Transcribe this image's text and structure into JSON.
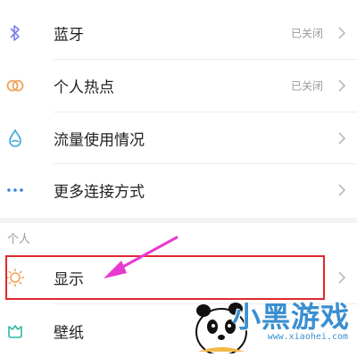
{
  "settings": {
    "items": [
      {
        "label": "蓝牙",
        "status": "已关闭",
        "icon": "bluetooth-icon",
        "icon_color": "#7b7fe6"
      },
      {
        "label": "个人热点",
        "status": "已关闭",
        "icon": "hotspot-icon",
        "icon_color": "#f0a25a"
      },
      {
        "label": "流量使用情况",
        "status": "",
        "icon": "data-usage-icon",
        "icon_color": "#3aa7d9"
      },
      {
        "label": "更多连接方式",
        "status": "",
        "icon": "more-connections-icon",
        "icon_color": "#3a7fd9"
      }
    ],
    "personal_section": {
      "header": "个人",
      "items": [
        {
          "label": "显示",
          "icon": "display-icon",
          "icon_color": "#f0a25a",
          "highlighted": true
        },
        {
          "label": "壁纸",
          "icon": "wallpaper-icon",
          "icon_color": "#2fb7a2"
        }
      ]
    }
  },
  "annotation": {
    "highlight_color": "#e0282e",
    "arrow_color": "#e83ad0"
  },
  "watermark": {
    "text": "小黑游戏",
    "url": "www.xiaohei.com"
  }
}
